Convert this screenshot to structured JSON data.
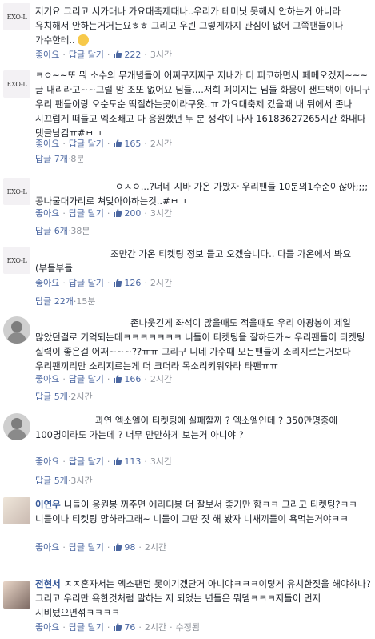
{
  "labels": {
    "like": "좋아요",
    "reply": "답글 달기",
    "sep": "·",
    "edited": "수정됨"
  },
  "avatar_logo": "EXO-L",
  "comments": [
    {
      "author": "",
      "text": "저기요 그리고 서가대나 가요대축제때나..우리가 테미닛 못해서 안하는거 아니라 유치해서 안하는거거든요ㅎㅎ 그리고 우린 그렇게까지 관심이 없어 그쪽팬들이나 가수한테..",
      "likes": "222",
      "time": "3시간",
      "reply_label": "",
      "reply_time": ""
    },
    {
      "author": "",
      "text": "ㅋㅇ~~또 뭐 소수의 무개념들이 어쩌구저쩌구 지내가 더 피코하면서 페메오겠지~~~글 내리라고~~그럴 맘 조또 없어요 님들....저희 페이지는 님들 화뭉이 샌드백이 아니구 우리 팬들이랑 오순도순 떡질하는곳이라구욧..ㅠ 가요대축제 갔을때 내 뒤에서 존나 시끄럽게 떠들고 엑소빼고 다 응원했던 두 분 생각이 나사 16183627265시간 화내다 댓글남김ㅠ#ㅂㄱ",
      "likes": "165",
      "time": "2시간",
      "reply_label": "답글 7개",
      "reply_time": "8분"
    },
    {
      "author": "",
      "text": "ㅇㅅㅇ...?너네 시바 가온 가봤자 우리팬들 10분의1수준이잖아;;;;콩나물대가리로 쳐맞아야하는것..#ㅂㄱ",
      "likes": "200",
      "time": "3시간",
      "reply_label": "답글 6개",
      "reply_time": "38분"
    },
    {
      "author": "",
      "text": "조만간 가온 티켓팅 정보 들고 오겠습니다.. 다들 가온에서 봐요 (부들부들",
      "likes": "126",
      "time": "2시간",
      "reply_label": "답글 22개",
      "reply_time": "15분"
    },
    {
      "author": "",
      "text": "존나웃긴게 좌석이 많을때도 적을때도 우리 아광봉이 제일 많았던걸로 기억되는데ㅋㅋㅋㅋㅋㅋㅋ 니들이 티켓팅을 잘하든가~ 우리팬들이 티켓팅 실력이 좋은걸 어째~~~??ㅠㅠ 그리구 니네 가수때 모든팬들이 소리지르는거보다 우리팬끼리만 소리지르는게 더 크더라 목소리키워와라 타팬ㅠㅠ",
      "likes": "166",
      "time": "2시간",
      "reply_label": "답글 5개",
      "reply_time": "2시간"
    },
    {
      "author": "",
      "text": "과연 엑소엘이 티켓팅에 실패할까 ? 엑소엘인데 ? 350만명중에 100명이라도 가는데 ? 너무 만만하게 보는거 아니야 ?",
      "likes": "113",
      "time": "3시간",
      "reply_label": "답글 5개",
      "reply_time": "3시간"
    },
    {
      "author": "이연우",
      "text": "니들이 응원봉 꺼주면 에리디봉 더 잘보서 좋기만 함ㅋㅋ 그리고 티켓팅?ㅋㅋ 니들이나 티켓팅 망하라그래~ 니들이 그딴 짓 해 봤자 니새끼들이 욕먹는거야ㅋㅋ",
      "likes": "98",
      "time": "2시간",
      "reply_label": "",
      "reply_time": ""
    },
    {
      "author": "전현서",
      "text": "ㅈㅈ혼자서는 엑소팬덤 못이기겠단거 아니야ㅋㅋㅋ이렇게 유치한짓을 해야하나?그리고 우리만 욕한것처럼 말하는 저 되었는 년들은 뭐뎀ㅋㅋㅋ지들이 먼저 시비텄으면섞ㅋㅋㅋㅋ",
      "likes": "76",
      "time": "2시간",
      "reply_label": "",
      "reply_time": ""
    }
  ]
}
